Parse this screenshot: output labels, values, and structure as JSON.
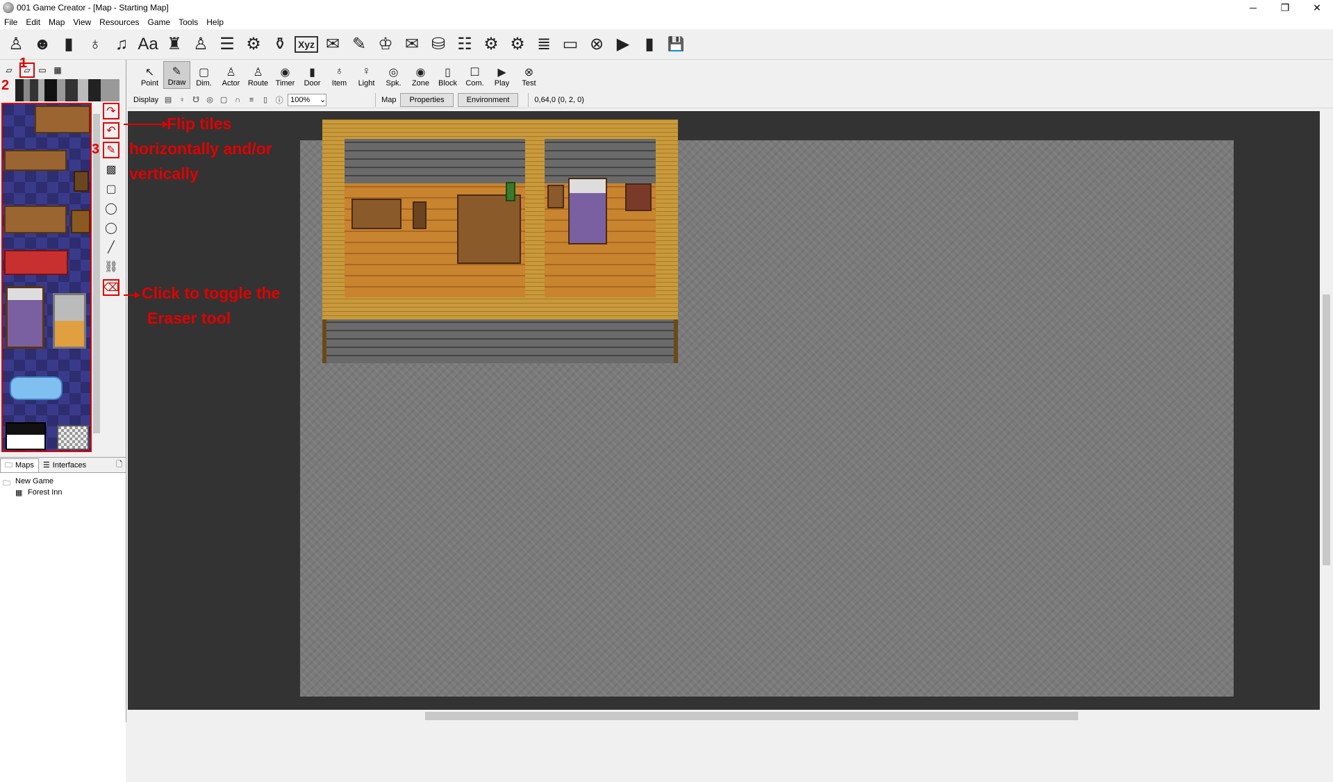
{
  "window": {
    "title": "001 Game Creator - [Map - Starting Map]",
    "controls": [
      "─",
      "❐",
      "✕"
    ]
  },
  "menu": [
    "File",
    "Edit",
    "Map",
    "View",
    "Resources",
    "Game",
    "Tools",
    "Help"
  ],
  "main_toolbar_icons": [
    "♙",
    "☻",
    "▮",
    "♁",
    "♫",
    "Aa",
    "♜",
    "♙",
    "☰",
    "⚙",
    "⚱",
    "Xyz",
    "✉",
    "✎",
    "♔",
    "✉",
    "⛁",
    "☷",
    "⚙",
    "⚙",
    "≣",
    "▭",
    "⊗",
    "▶",
    "▮",
    "💾"
  ],
  "palette_tabs": [
    "▱",
    "▱",
    "▭",
    "▦"
  ],
  "tools": [
    "↷",
    "↶",
    "✎",
    "▩",
    "▢",
    "◯",
    "◯",
    "╱",
    "⛓",
    "⌫"
  ],
  "project_tabs": {
    "maps": "Maps",
    "interfaces": "Interfaces"
  },
  "tree": {
    "root": "New Game",
    "child": "Forest Inn"
  },
  "edit_tools": [
    {
      "icon": "↖",
      "label": "Point"
    },
    {
      "icon": "✎",
      "label": "Draw"
    },
    {
      "icon": "▢",
      "label": "Dim."
    },
    {
      "icon": "♙",
      "label": "Actor"
    },
    {
      "icon": "♙",
      "label": "Route"
    },
    {
      "icon": "◉",
      "label": "Timer"
    },
    {
      "icon": "▮",
      "label": "Door"
    },
    {
      "icon": "♁",
      "label": "Item"
    },
    {
      "icon": "♀",
      "label": "Light"
    },
    {
      "icon": "◎",
      "label": "Spk."
    },
    {
      "icon": "◉",
      "label": "Zone"
    },
    {
      "icon": "▯",
      "label": "Block"
    },
    {
      "icon": "☐",
      "label": "Com."
    },
    {
      "icon": "▶",
      "label": "Play"
    },
    {
      "icon": "⊗",
      "label": "Test"
    }
  ],
  "display_bar": {
    "label": "Display",
    "zoom": "100%",
    "map_label": "Map",
    "properties": "Properties",
    "environment": "Environment",
    "coords": "0,64,0 (0, 2, 0)"
  },
  "annotations": {
    "num1": "1",
    "num2": "2",
    "num3": "3",
    "flip_line1": "Flip tiles",
    "flip_line2": "horizontally and/or",
    "flip_line3": "vertically",
    "eraser_line1": "Click to toggle the",
    "eraser_line2": "Eraser tool"
  }
}
